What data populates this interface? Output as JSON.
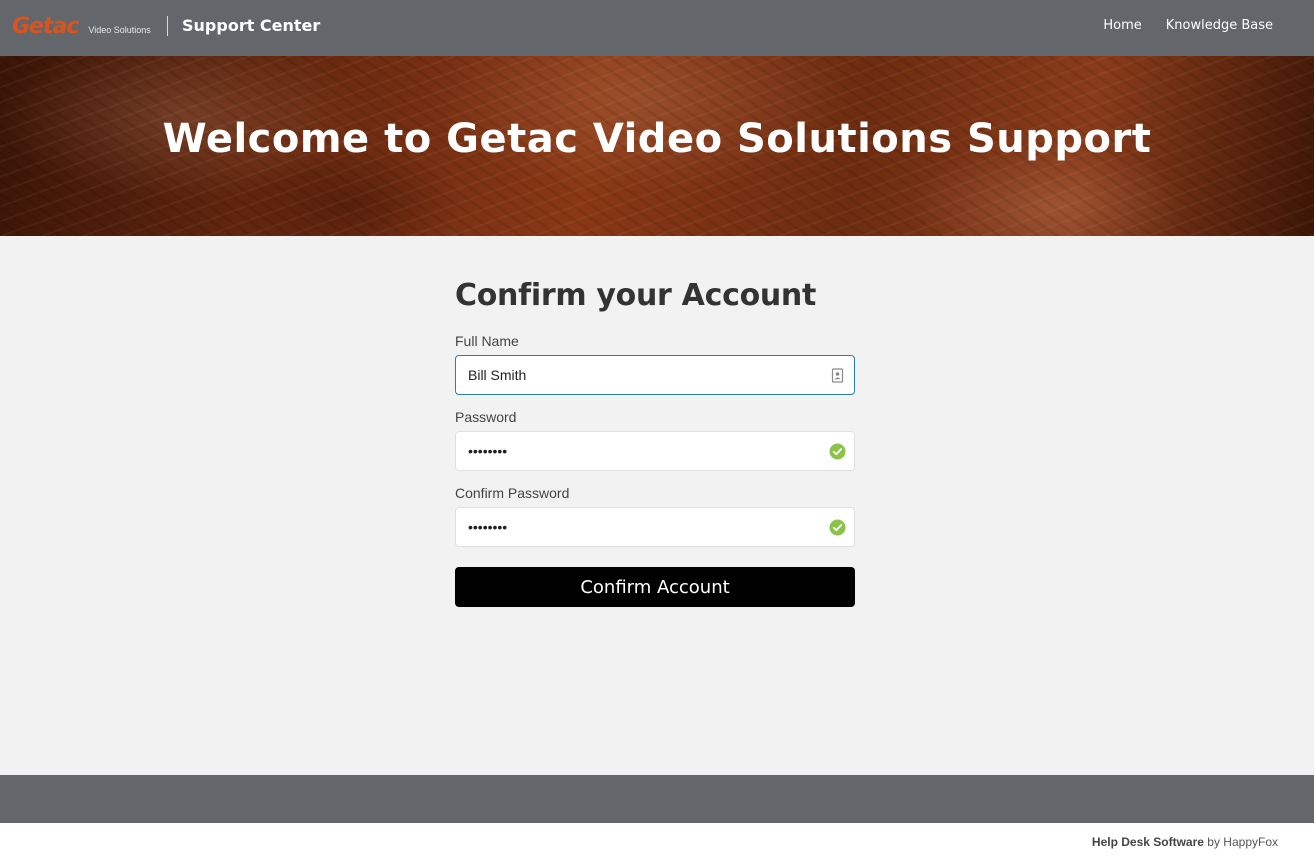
{
  "header": {
    "logo_text": "Getac",
    "logo_subtext": "Video Solutions",
    "title": "Support Center",
    "nav": [
      {
        "label": "Home"
      },
      {
        "label": "Knowledge Base"
      }
    ]
  },
  "hero": {
    "title": "Welcome to Getac Video Solutions Support"
  },
  "form": {
    "title": "Confirm your Account",
    "full_name": {
      "label": "Full Name",
      "value": "Bill Smith"
    },
    "password": {
      "label": "Password",
      "value": "••••••••"
    },
    "confirm_password": {
      "label": "Confirm Password",
      "value": "••••••••"
    },
    "submit_label": "Confirm Account"
  },
  "footer": {
    "product": "Help Desk Software",
    "by": "by HappyFox"
  },
  "colors": {
    "header_bg": "#63676b",
    "logo": "#d9531e",
    "check": "#8bc34a",
    "focus_border": "#2a7fa4",
    "button_bg": "#000000"
  },
  "icons": {
    "full_name": "contact-card-icon",
    "password_status": "check-circle-icon",
    "confirm_password_status": "check-circle-icon"
  }
}
